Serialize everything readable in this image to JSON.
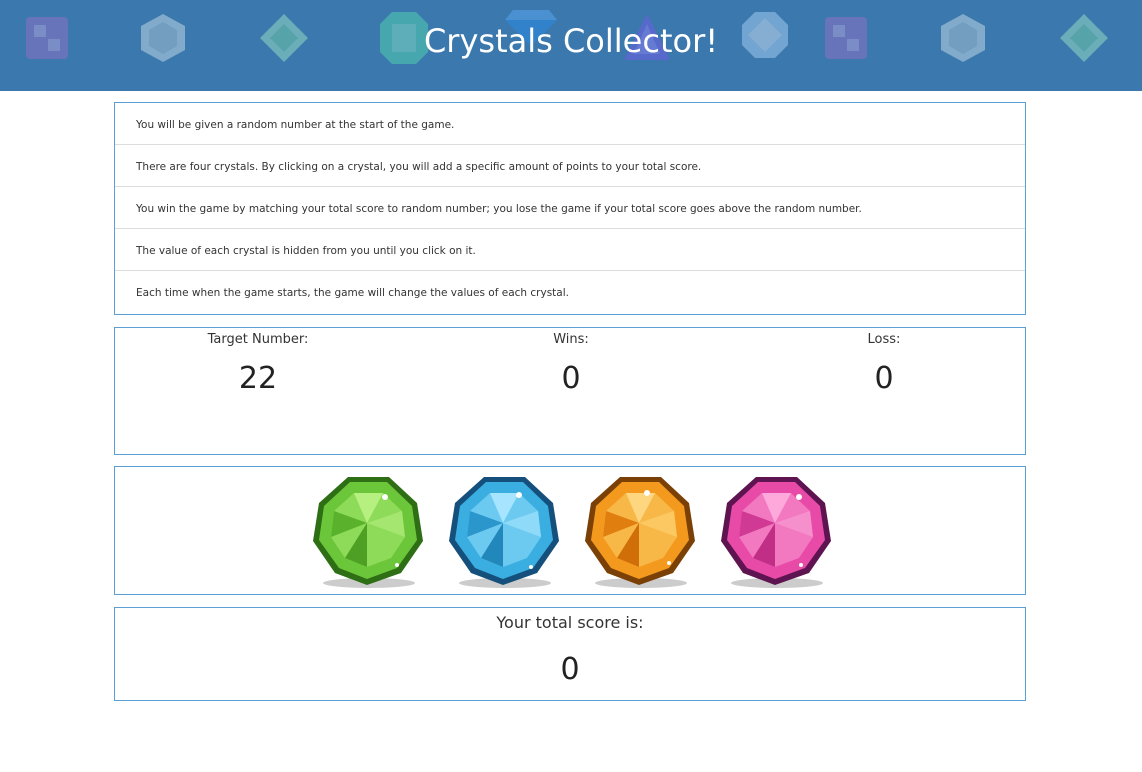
{
  "header": {
    "title": "Crystals Collector!",
    "background_color": "#3a78ad",
    "decor_icons": [
      "purple-square-gem-icon",
      "clear-hex-gem-icon",
      "green-rhombus-gem-icon",
      "green-emerald-gem-icon",
      "blue-diamond-gem-icon",
      "purple-triangle-gem-icon",
      "blue-round-gem-icon",
      "purple-square-gem-icon",
      "clear-hex-gem-icon",
      "green-rhombus-gem-icon"
    ]
  },
  "instructions": [
    "You will be given a random number at the start of the game.",
    "There are four crystals. By clicking on a crystal, you will add a specific amount of points to your total score.",
    "You win the game by matching your total score to random number; you lose the game if your total score goes above the random number.",
    "The value of each crystal is hidden from you until you click on it.",
    "Each time when the game starts, the game will change the values of each crystal."
  ],
  "stats": {
    "target_label": "Target Number:",
    "target_value": "22",
    "wins_label": "Wins:",
    "wins_value": "0",
    "loss_label": "Loss:",
    "loss_value": "0"
  },
  "crystals": [
    {
      "name": "green-crystal-icon",
      "color": "#6cc63a"
    },
    {
      "name": "blue-crystal-icon",
      "color": "#3aaee0"
    },
    {
      "name": "orange-crystal-icon",
      "color": "#f39a1e"
    },
    {
      "name": "pink-crystal-icon",
      "color": "#e84aa8"
    }
  ],
  "score": {
    "label": "Your total score is:",
    "value": "0"
  },
  "colors": {
    "box_border": "#5aa0d6"
  }
}
